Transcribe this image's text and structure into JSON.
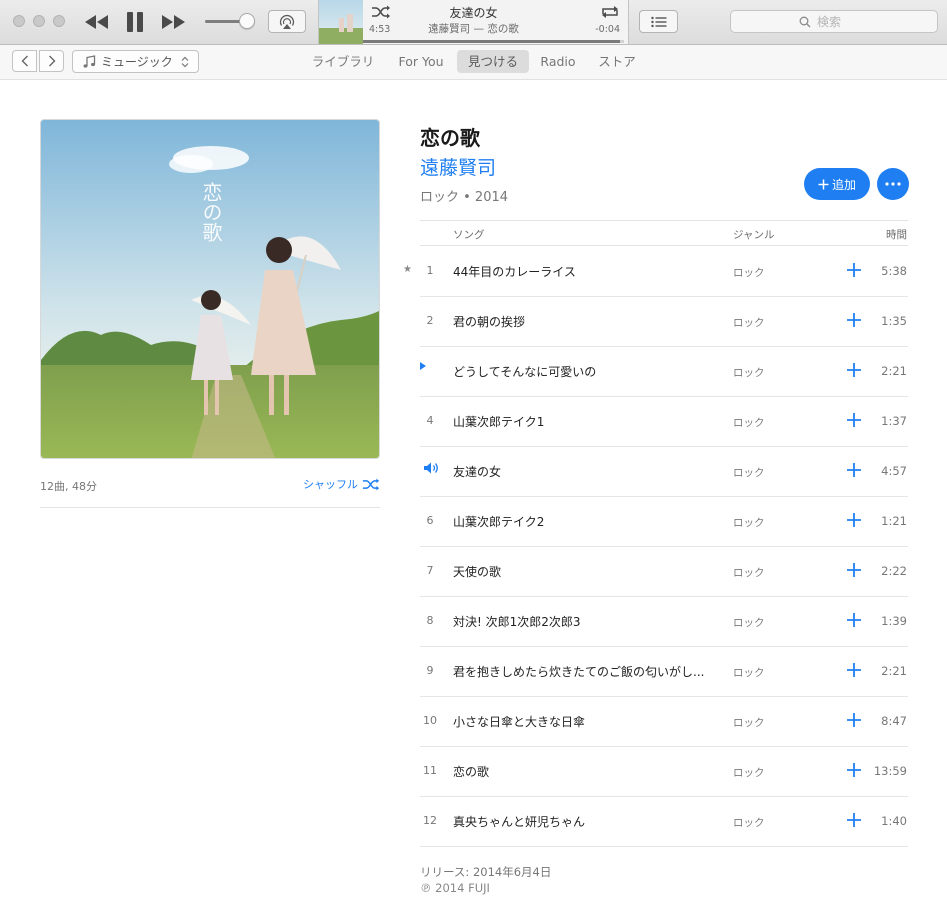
{
  "player": {
    "now_playing_title": "友達の女",
    "now_playing_subtitle": "遠藤賢司 — 恋の歌",
    "elapsed": "4:53",
    "remaining": "-0:04",
    "progress_fraction": 0.985,
    "volume_fraction": 0.75,
    "search_placeholder": "検索"
  },
  "nav": {
    "media_kind": "ミュージック",
    "tabs": [
      {
        "label": "ライブラリ",
        "active": false
      },
      {
        "label": "For You",
        "active": false
      },
      {
        "label": "見つける",
        "active": true
      },
      {
        "label": "Radio",
        "active": false
      },
      {
        "label": "ストア",
        "active": false
      }
    ]
  },
  "album": {
    "title": "恋の歌",
    "artist": "遠藤賢司",
    "meta": "ロック • 2014",
    "art_text": "恋の歌",
    "track_count": "12曲, 48分",
    "shuffle_label": "シャッフル",
    "add_label": "追加",
    "release": "リリース:  2014年6月4日",
    "copyright": "℗ 2014 FUJI"
  },
  "columns": {
    "song": "ソング",
    "genre": "ジャンル",
    "time": "時間"
  },
  "tracks": [
    {
      "num": "1",
      "title": "44年目のカレーライス",
      "genre": "ロック",
      "time": "5:38",
      "marker": "star"
    },
    {
      "num": "2",
      "title": "君の朝の挨拶",
      "genre": "ロック",
      "time": "1:35",
      "marker": ""
    },
    {
      "num": "",
      "title": "どうしてそんなに可愛いの",
      "genre": "ロック",
      "time": "2:21",
      "marker": "play"
    },
    {
      "num": "4",
      "title": "山葉次郎テイク1",
      "genre": "ロック",
      "time": "1:37",
      "marker": ""
    },
    {
      "num": "",
      "title": "友達の女",
      "genre": "ロック",
      "time": "4:57",
      "marker": "playing"
    },
    {
      "num": "6",
      "title": "山葉次郎テイク2",
      "genre": "ロック",
      "time": "1:21",
      "marker": ""
    },
    {
      "num": "7",
      "title": "天使の歌",
      "genre": "ロック",
      "time": "2:22",
      "marker": ""
    },
    {
      "num": "8",
      "title": "対決! 次郎1次郎2次郎3",
      "genre": "ロック",
      "time": "1:39",
      "marker": ""
    },
    {
      "num": "9",
      "title": "君を抱きしめたら炊きたてのご飯の匂いがし...",
      "genre": "ロック",
      "time": "2:21",
      "marker": ""
    },
    {
      "num": "10",
      "title": "小さな日傘と大きな日傘",
      "genre": "ロック",
      "time": "8:47",
      "marker": ""
    },
    {
      "num": "11",
      "title": "恋の歌",
      "genre": "ロック",
      "time": "13:59",
      "marker": ""
    },
    {
      "num": "12",
      "title": "真央ちゃんと妍児ちゃん",
      "genre": "ロック",
      "time": "1:40",
      "marker": ""
    }
  ],
  "colors": {
    "accent": "#1f7ff2"
  }
}
